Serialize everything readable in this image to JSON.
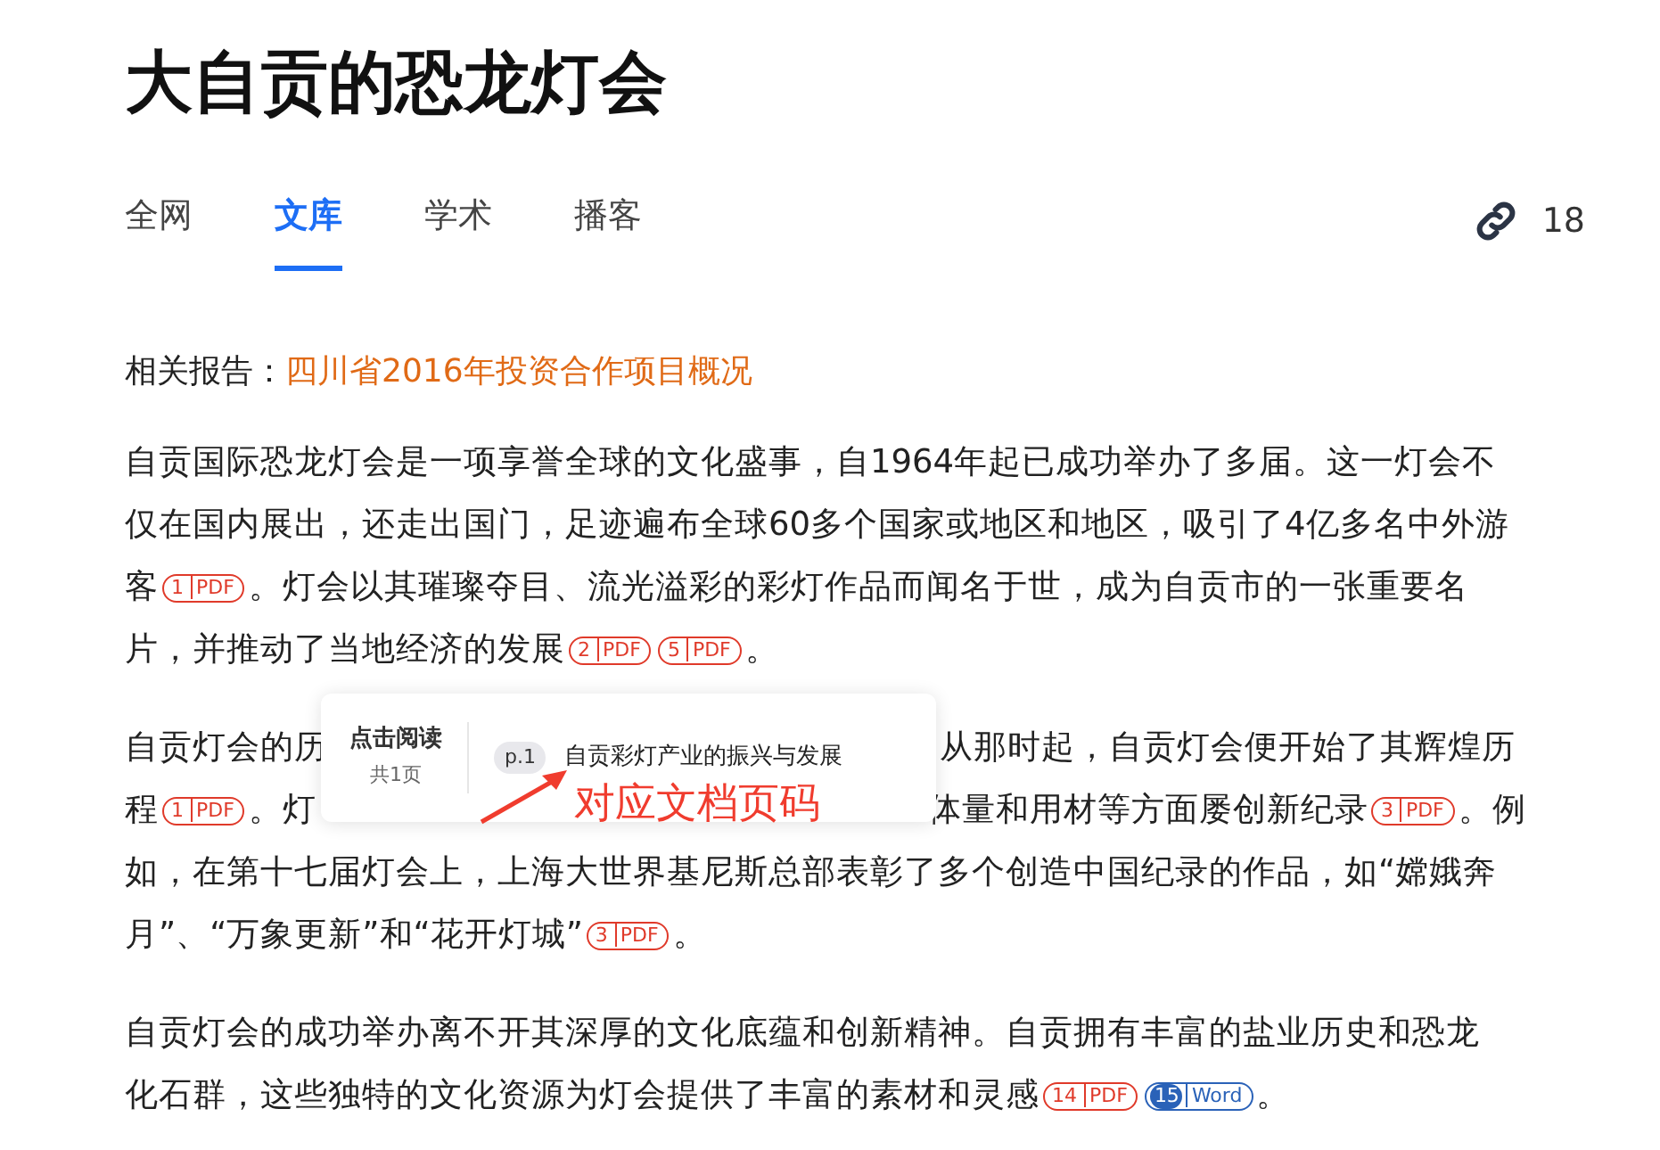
{
  "title": "大自贡的恐龙灯会",
  "tabs": [
    {
      "label": "全网",
      "selected": false
    },
    {
      "label": "文库",
      "selected": true
    },
    {
      "label": "学术",
      "selected": false
    },
    {
      "label": "播客",
      "selected": false
    }
  ],
  "link_count": "18",
  "related": {
    "label": "相关报告：",
    "link": "四川省2016年投资合作项目概况"
  },
  "paragraphs": [
    {
      "items": [
        {
          "kind": "text",
          "text": "自贡国际恐龙灯会是一项享誉全球的文化盛事，自1964年起已成功举办了多届。这一灯会不"
        },
        {
          "kind": "break"
        },
        {
          "kind": "text",
          "text": "仅在国内展出，还走出国门，足迹遍布全球60多个国家或地区和地区，吸引了4亿多名中外游"
        },
        {
          "kind": "break"
        },
        {
          "kind": "text",
          "text": "客"
        },
        {
          "kind": "pdf",
          "num": "1",
          "type": "PDF"
        },
        {
          "kind": "text",
          "text": "。灯会以其璀璨夺目、流光溢彩的彩灯作品而闻名于世，成为自贡市的一张重要名"
        },
        {
          "kind": "break"
        },
        {
          "kind": "text",
          "text": "片，并推动了当地经济的发展"
        },
        {
          "kind": "pdf",
          "num": "2",
          "type": "PDF"
        },
        {
          "kind": "pdf",
          "num": "5",
          "type": "PDF"
        },
        {
          "kind": "text",
          "text": "。"
        }
      ]
    },
    {
      "items": [
        {
          "kind": "text",
          "text": "自贡灯会的历"
        },
        {
          "kind": "gap"
        },
        {
          "kind": "text",
          "text": "从那时起，自贡灯会便开始了其辉煌历"
        },
        {
          "kind": "break"
        },
        {
          "kind": "text",
          "text": "程"
        },
        {
          "kind": "pdf",
          "num": "1",
          "type": "PDF"
        },
        {
          "kind": "text",
          "text": "。灯"
        },
        {
          "kind": "gap"
        },
        {
          "kind": "text",
          "text": "体量和用材等方面屡创新纪录"
        },
        {
          "kind": "pdf",
          "num": "3",
          "type": "PDF"
        },
        {
          "kind": "text",
          "text": "。例"
        },
        {
          "kind": "break"
        },
        {
          "kind": "text",
          "text": "如，在第十七届灯会上，上海大世界基尼斯总部表彰了多个创造中国纪录的作品，如“嫦娥奔"
        },
        {
          "kind": "break"
        },
        {
          "kind": "text",
          "text": "月”、“万象更新”和“花开灯城”"
        },
        {
          "kind": "pdf",
          "num": "3",
          "type": "PDF"
        },
        {
          "kind": "text",
          "text": "。"
        }
      ],
      "popup": {
        "action": "点击阅读",
        "pages": "共1页",
        "page_tag": "p.1",
        "doc_title": "自贡彩灯产业的振兴与发展"
      },
      "annotation": "对应文档页码"
    },
    {
      "items": [
        {
          "kind": "text",
          "text": "自贡灯会的成功举办离不开其深厚的文化底蕴和创新精神。自贡拥有丰富的盐业历史和恐龙"
        },
        {
          "kind": "break"
        },
        {
          "kind": "text",
          "text": "化石群，这些独特的文化资源为灯会提供了丰富的素材和灵感"
        },
        {
          "kind": "pdf",
          "num": "14",
          "type": "PDF"
        },
        {
          "kind": "word",
          "num": "15",
          "type": "Word"
        },
        {
          "kind": "text",
          "text": "。"
        }
      ]
    }
  ]
}
